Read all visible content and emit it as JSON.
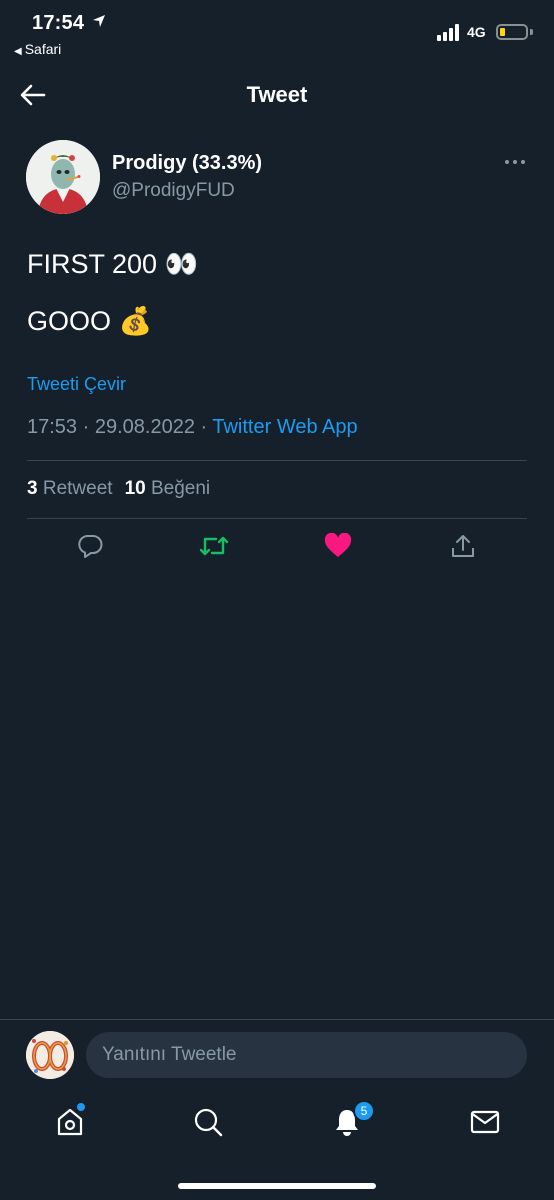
{
  "status_bar": {
    "time": "17:54",
    "back_app": "Safari",
    "network": "4G",
    "battery_color": "#ffd60a"
  },
  "header": {
    "title": "Tweet"
  },
  "tweet": {
    "author_name": "Prodigy (33.3%)",
    "author_handle": "@ProdigyFUD",
    "lines": [
      "FIRST 200 👀",
      "GOOO 💰"
    ],
    "translate_label": "Tweeti Çevir",
    "time": "17:53",
    "date": "29.08.2022",
    "source": "Twitter Web App",
    "retweet_count": "3",
    "retweet_label": "Retweet",
    "like_count": "10",
    "like_label": "Beğeni",
    "liked": true,
    "retweeted": true
  },
  "reply": {
    "placeholder": "Yanıtını Tweetle"
  },
  "tab_bar": {
    "notifications_badge": "5"
  },
  "colors": {
    "background": "#15202b",
    "accent": "#1d9bf0",
    "retweet": "#17bf63",
    "like": "#f91880",
    "muted": "#8899a6"
  },
  "icons": [
    "back-arrow-icon",
    "location-arrow-icon",
    "more-icon",
    "reply-icon",
    "retweet-icon",
    "like-icon",
    "share-icon",
    "home-icon",
    "search-icon",
    "bell-icon",
    "mail-icon"
  ]
}
